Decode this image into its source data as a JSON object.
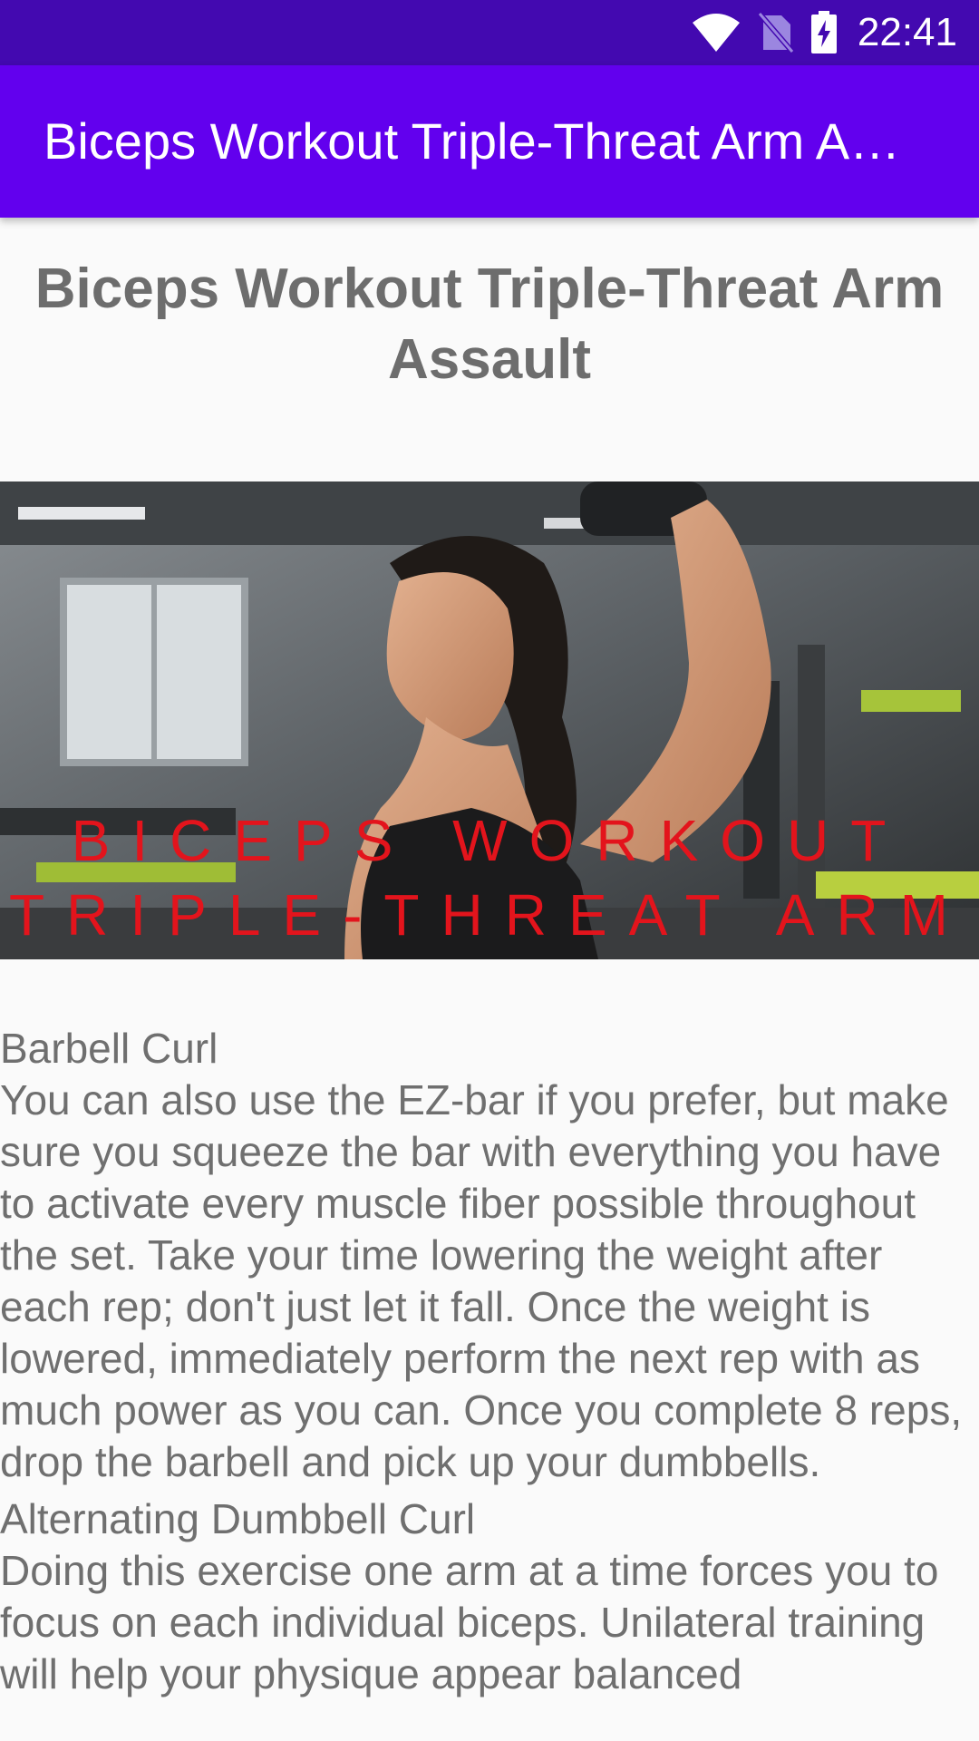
{
  "status_bar": {
    "time": "22:41",
    "icons": [
      "wifi-icon",
      "no-sim-icon",
      "battery-charging-icon"
    ],
    "background": "#4309b0"
  },
  "app_bar": {
    "title": "Biceps Workout Triple-Threat Arm Assault",
    "background": "#6200ee"
  },
  "article": {
    "title": "Biceps Workout Triple-Threat Arm Assault",
    "hero_caption": "Biceps Workout Triple-Threat Arm Assault",
    "sections": [
      {
        "heading": "Barbell Curl",
        "body": " You can also use the EZ-bar if you prefer, but make sure you squeeze the bar with everything you have to activate every muscle fiber possible throughout the set. Take your time lowering the weight after each rep; don't just let it fall. Once the weight is lowered, immediately perform the next rep with as much power as you can. Once you complete 8 reps, drop the barbell and pick up your dumbbells."
      },
      {
        "heading": "Alternating Dumbbell Curl",
        "body": " Doing this exercise one arm at a time forces you to focus on each individual biceps. Unilateral training will help your physique appear balanced"
      }
    ]
  },
  "colors": {
    "text_gray": "#6f6f6f",
    "caption_red": "#e3141c",
    "page_background": "#fafafa"
  }
}
